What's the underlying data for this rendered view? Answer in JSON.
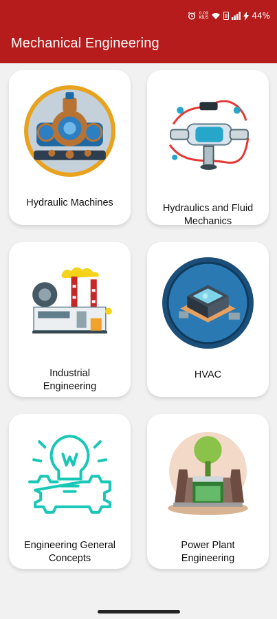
{
  "status_bar": {
    "speed": "0.09\nKB/S",
    "battery": "44%",
    "icons": [
      "alarm-icon",
      "wifi-icon",
      "volte-icon",
      "signal-icon",
      "charging-icon"
    ]
  },
  "app_bar": {
    "title": "Mechanical Engineering",
    "color": "#b71c1c"
  },
  "cards": [
    {
      "label": "Hydraulic Machines",
      "icon": "hydraulic-machine-icon"
    },
    {
      "label": "Hydraulics and Fluid Mechanics",
      "icon": "fluid-pipeline-icon"
    },
    {
      "label": "Industrial Engineering",
      "icon": "factory-icon"
    },
    {
      "label": "HVAC",
      "icon": "hvac-unit-icon"
    },
    {
      "label": "Engineering General Concepts",
      "icon": "lightbulb-gear-icon"
    },
    {
      "label": "Power Plant Engineering",
      "icon": "power-plant-icon"
    }
  ]
}
